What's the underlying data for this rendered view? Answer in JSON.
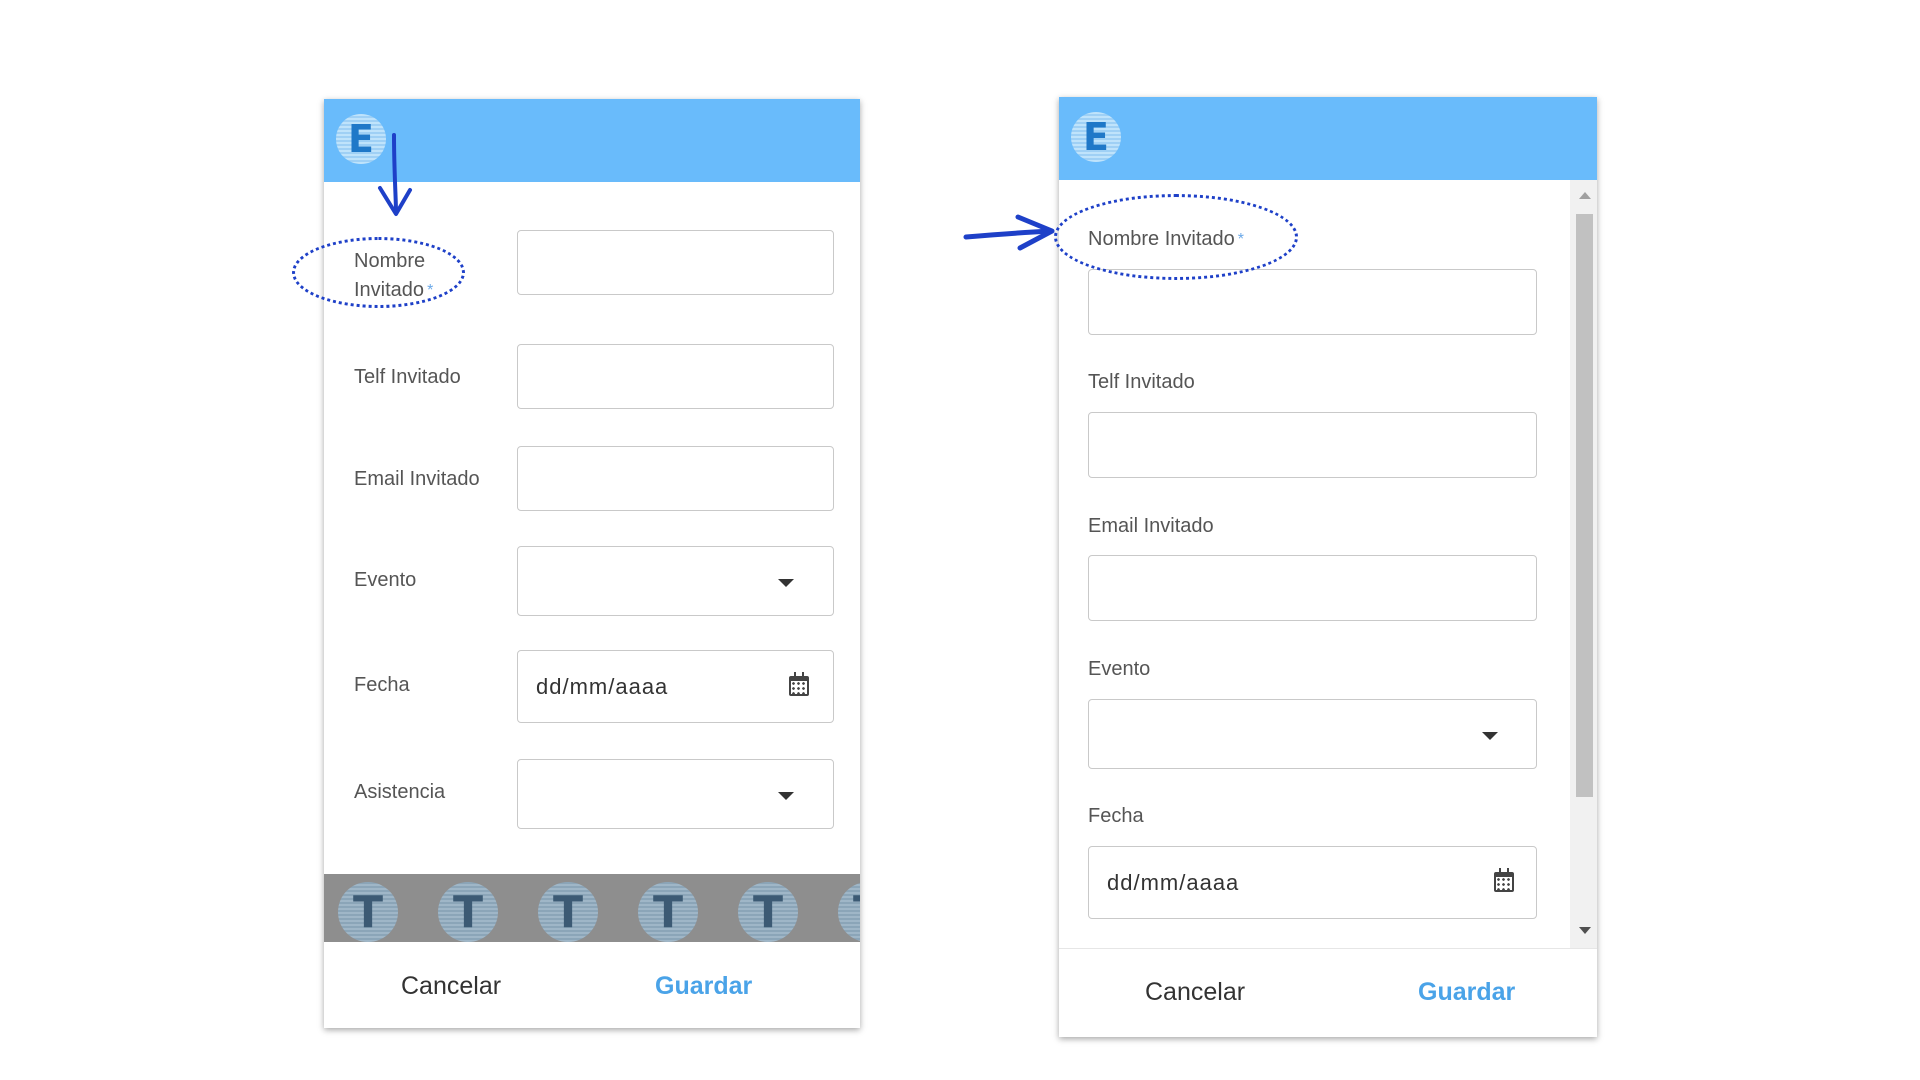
{
  "left_form": {
    "fields": [
      {
        "label": "Nombre Invitado",
        "required_mark": "*"
      },
      {
        "label": "Telf Invitado"
      },
      {
        "label": "Email Invitado"
      },
      {
        "label": "Evento"
      },
      {
        "label": "Fecha",
        "placeholder": "dd/mm/aaaa"
      },
      {
        "label": "Asistencia"
      }
    ],
    "buttons": {
      "cancel": "Cancelar",
      "save": "Guardar"
    }
  },
  "right_form": {
    "fields": [
      {
        "label": "Nombre Invitado",
        "required_mark": "*"
      },
      {
        "label": "Telf Invitado"
      },
      {
        "label": "Email Invitado"
      },
      {
        "label": "Evento"
      },
      {
        "label": "Fecha",
        "placeholder": "dd/mm/aaaa"
      }
    ],
    "buttons": {
      "cancel": "Cancelar",
      "save": "Guardar"
    }
  },
  "logo_letter": "E",
  "watermark_letter": "T",
  "colors": {
    "header": "#69bbfb",
    "accent": "#4aa3e8",
    "annotation": "#1e40c8"
  },
  "icons": [
    "logo-e-icon",
    "caret-down-icon",
    "calendar-icon",
    "arrow-down-annotation",
    "arrow-right-annotation"
  ]
}
